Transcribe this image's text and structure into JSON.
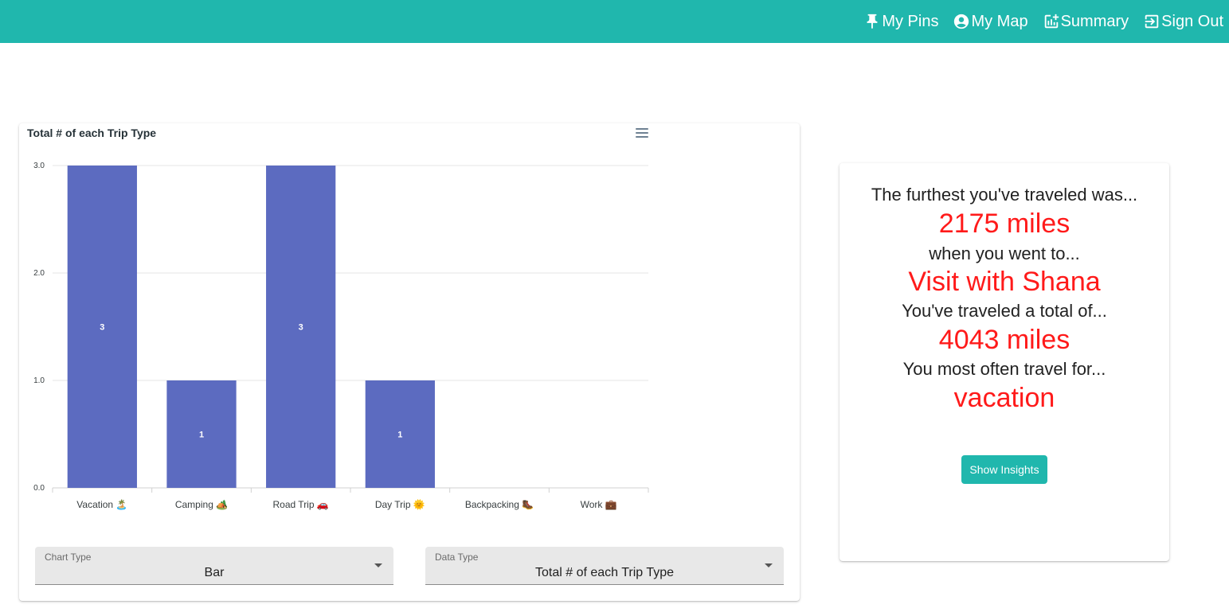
{
  "colors": {
    "accent": "#20b7ad",
    "bar": "#5c6bc0",
    "highlight": "#ff1a1a"
  },
  "nav": {
    "items": [
      {
        "label": "My Pins",
        "icon": "pin-icon"
      },
      {
        "label": "My Map",
        "icon": "account-circle-icon"
      },
      {
        "label": "Summary",
        "icon": "chart-add-icon"
      },
      {
        "label": "Sign Out",
        "icon": "sign-out-icon"
      }
    ]
  },
  "chart": {
    "menu_icon": "hamburger-menu-icon"
  },
  "chart_data": {
    "type": "bar",
    "title": "Total # of each Trip Type",
    "categories": [
      "Vacation 🏝️",
      "Camping 🏕️",
      "Road Trip 🚗",
      "Day Trip 🌞",
      "Backpacking 🥾",
      "Work 💼"
    ],
    "values": [
      3,
      1,
      3,
      1,
      0,
      0
    ],
    "data_labels": [
      "3",
      "1",
      "3",
      "1",
      "",
      ""
    ],
    "ylim": [
      0,
      3
    ],
    "yticks": [
      "0.0",
      "1.0",
      "2.0",
      "3.0"
    ],
    "xlabel": "",
    "ylabel": "",
    "grid": true,
    "legend": false
  },
  "controls": {
    "chart_type": {
      "label": "Chart Type",
      "value": "Bar"
    },
    "data_type": {
      "label": "Data Type",
      "value": "Total # of each Trip Type"
    }
  },
  "insights": {
    "line1": "The furthest you've traveled was...",
    "value1": "2175 miles",
    "line2": "when you went to...",
    "value2": "Visit with Shana",
    "line3": "You've traveled a total of...",
    "value3": "4043 miles",
    "line4": "You most often travel for...",
    "value4": "vacation",
    "button_label": "Show Insights"
  }
}
